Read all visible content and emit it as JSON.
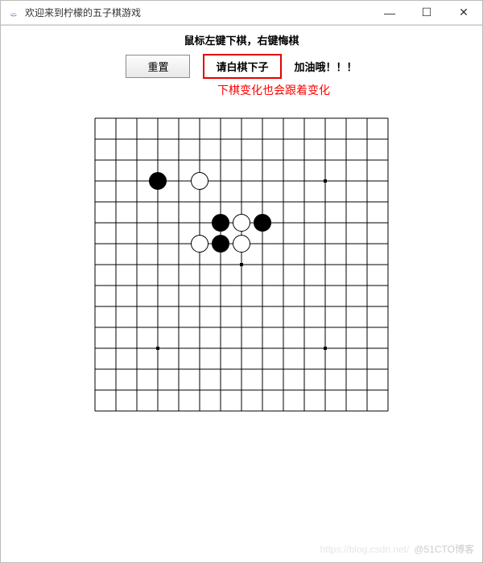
{
  "window": {
    "title": "欢迎来到柠檬的五子棋游戏",
    "minimize_glyph": "—",
    "maximize_glyph": "☐",
    "close_glyph": "✕"
  },
  "instruction": "鼠标左键下棋，右键悔棋",
  "toolbar": {
    "reset_label": "重置",
    "status_label": "请白棋下子",
    "cheer_label": "加油哦！！！"
  },
  "annotation": "下棋变化也会跟着变化",
  "board": {
    "size": 15,
    "cell": 26,
    "margin": 13,
    "star_points": [
      [
        3,
        3
      ],
      [
        11,
        3
      ],
      [
        7,
        7
      ],
      [
        3,
        11
      ],
      [
        11,
        11
      ]
    ],
    "stones": [
      {
        "col": 3,
        "row": 3,
        "color": "black"
      },
      {
        "col": 5,
        "row": 3,
        "color": "white"
      },
      {
        "col": 5,
        "row": 6,
        "color": "white"
      },
      {
        "col": 6,
        "row": 5,
        "color": "black"
      },
      {
        "col": 6,
        "row": 6,
        "color": "black"
      },
      {
        "col": 7,
        "row": 5,
        "color": "white"
      },
      {
        "col": 8,
        "row": 5,
        "color": "black"
      },
      {
        "col": 7,
        "row": 6,
        "color": "white"
      }
    ]
  },
  "watermark": {
    "faint": "https://blog.csdn.net/",
    "handle": "@51CTO博客"
  }
}
